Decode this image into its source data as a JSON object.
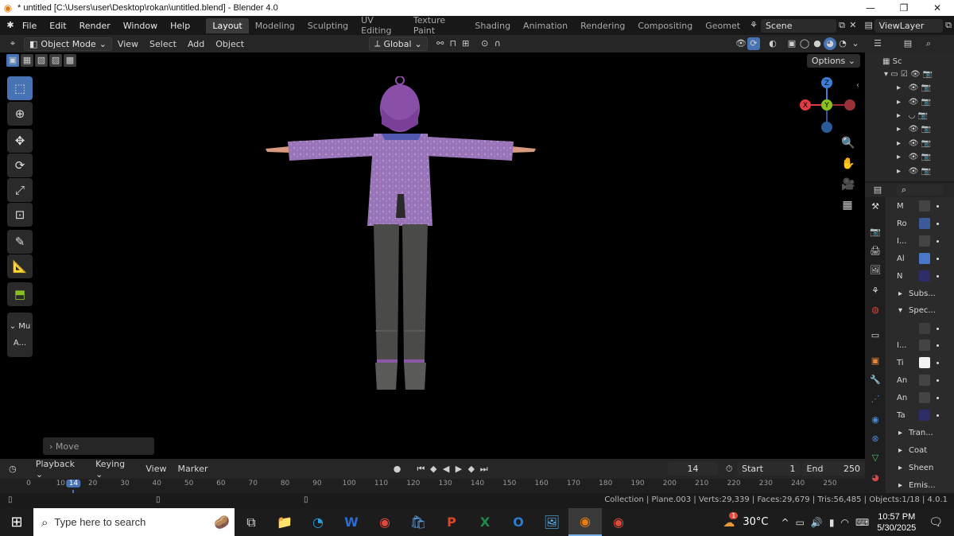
{
  "window": {
    "title": "* untitled [C:\\Users\\user\\Desktop\\rokan\\untitled.blend] - Blender 4.0",
    "min": "—",
    "max": "❐",
    "close": "✕"
  },
  "menu": {
    "items": [
      "File",
      "Edit",
      "Render",
      "Window",
      "Help"
    ],
    "workspaces": [
      "Layout",
      "Modeling",
      "Sculpting",
      "UV Editing",
      "Texture Paint",
      "Shading",
      "Animation",
      "Rendering",
      "Compositing",
      "Geomet"
    ],
    "active_workspace": "Layout",
    "scene": "Scene",
    "view_layer": "ViewLayer"
  },
  "viewport_header": {
    "mode": "Object Mode",
    "menus": [
      "View",
      "Select",
      "Add",
      "Object"
    ],
    "orientation": "Global",
    "options": "Options"
  },
  "toolbar": {
    "collapsed_label": "Mu",
    "sub_label": "A..."
  },
  "operator_panel": {
    "label": "Move"
  },
  "outliner": {
    "header": "Sc"
  },
  "properties": {
    "rows": [
      {
        "label": "M",
        "swatch": "#444444"
      },
      {
        "label": "Ro",
        "swatch": "#3a5a9a"
      },
      {
        "label": "I...",
        "swatch": "#444444"
      },
      {
        "label": "Al",
        "swatch": "#4a78c8"
      },
      {
        "label": "N",
        "swatch": "#2d2d6a"
      },
      {
        "label": "Subs...",
        "swatch": ""
      },
      {
        "label": "Spec...",
        "swatch": ""
      },
      {
        "label": "",
        "swatch": "#3d3d3d"
      },
      {
        "label": "I...",
        "swatch": "#444444"
      },
      {
        "label": "Ti",
        "swatch": "#f2f2f2"
      },
      {
        "label": "An",
        "swatch": "#444444"
      },
      {
        "label": "An",
        "swatch": "#444444"
      },
      {
        "label": "Ta",
        "swatch": "#2d2d6a"
      },
      {
        "label": "Tran...",
        "swatch": ""
      },
      {
        "label": "Coat",
        "swatch": ""
      },
      {
        "label": "Sheen",
        "swatch": ""
      },
      {
        "label": "Emis...",
        "swatch": ""
      }
    ]
  },
  "timeline": {
    "menus": [
      "Playback",
      "Keying",
      "View",
      "Marker"
    ],
    "current_frame": "14",
    "start_label": "Start",
    "start": "1",
    "end_label": "End",
    "end": "250",
    "ticks": [
      "0",
      "10",
      "14",
      "20",
      "30",
      "40",
      "50",
      "60",
      "70",
      "80",
      "90",
      "100",
      "110",
      "120",
      "130",
      "140",
      "150",
      "160",
      "170",
      "180",
      "190",
      "200",
      "210",
      "220",
      "230",
      "240",
      "250"
    ]
  },
  "status": {
    "text": "Collection | Plane.003 | Verts:29,339 | Faces:29,679 | Tris:56,485 | Objects:1/18 | 4.0.1"
  },
  "taskbar": {
    "search_placeholder": "Type here to search",
    "temperature": "30°C",
    "time": "10:57 PM",
    "date": "5/30/2025",
    "badge": "1"
  },
  "colors": {
    "accent": "#4772b3",
    "viewport_bg": "#000000",
    "gizmo_x": "#e03c44",
    "gizmo_y": "#8ac11e",
    "gizmo_z": "#3c7fd8"
  }
}
